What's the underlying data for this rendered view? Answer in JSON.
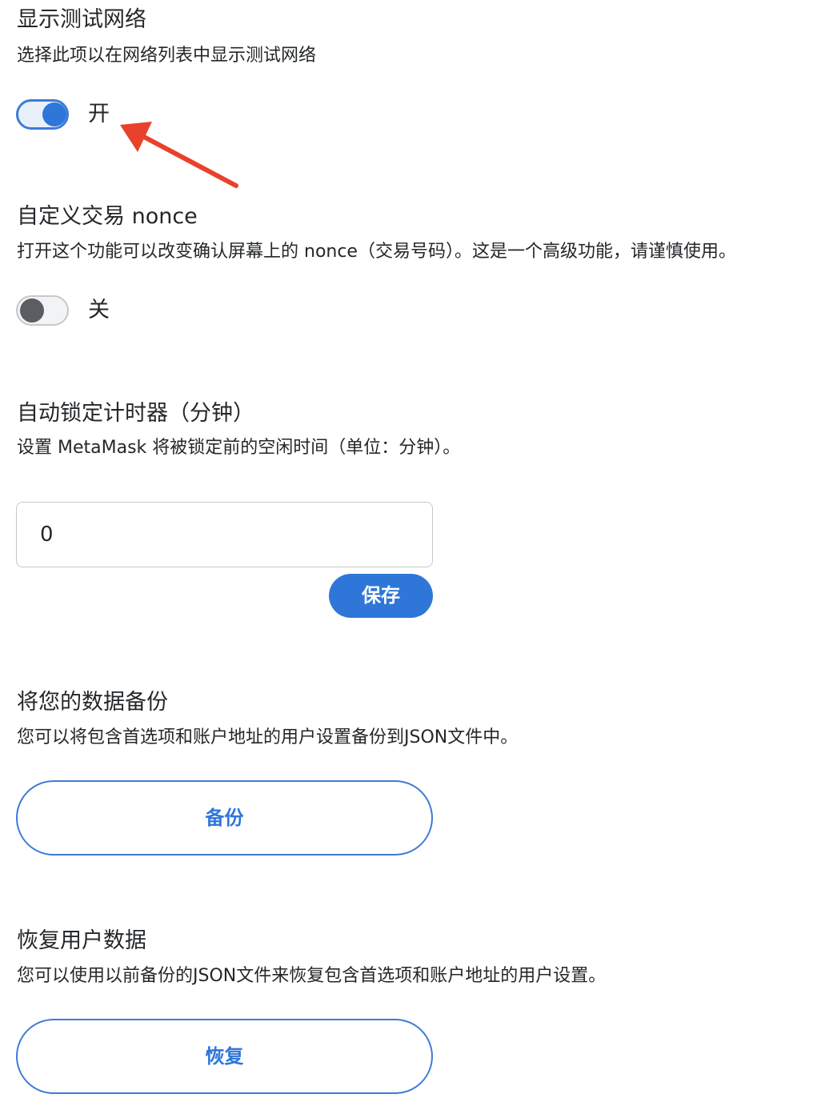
{
  "test_networks": {
    "title": "显示测试网络",
    "description": "选择此项以在网络列表中显示测试网络",
    "toggle_state": "on",
    "toggle_label": "开"
  },
  "custom_nonce": {
    "title": "自定义交易 nonce",
    "description": "打开这个功能可以改变确认屏幕上的 nonce（交易号码）。这是一个高级功能，请谨慎使用。",
    "toggle_state": "off",
    "toggle_label": "关"
  },
  "auto_lock": {
    "title": "自动锁定计时器（分钟）",
    "description": "设置 MetaMask 将被锁定前的空闲时间（单位：分钟）。",
    "input_value": "0",
    "save_label": "保存"
  },
  "backup": {
    "title": "将您的数据备份",
    "description": "您可以将包含首选项和账户地址的用户设置备份到JSON文件中。",
    "button_label": "备份"
  },
  "restore": {
    "title": "恢复用户数据",
    "description": "您可以使用以前备份的JSON文件来恢复包含首选项和账户地址的用户设置。",
    "button_label": "恢复"
  },
  "colors": {
    "accent": "#2f76d9",
    "annotation_arrow": "#e8412c",
    "text": "#24272a"
  }
}
